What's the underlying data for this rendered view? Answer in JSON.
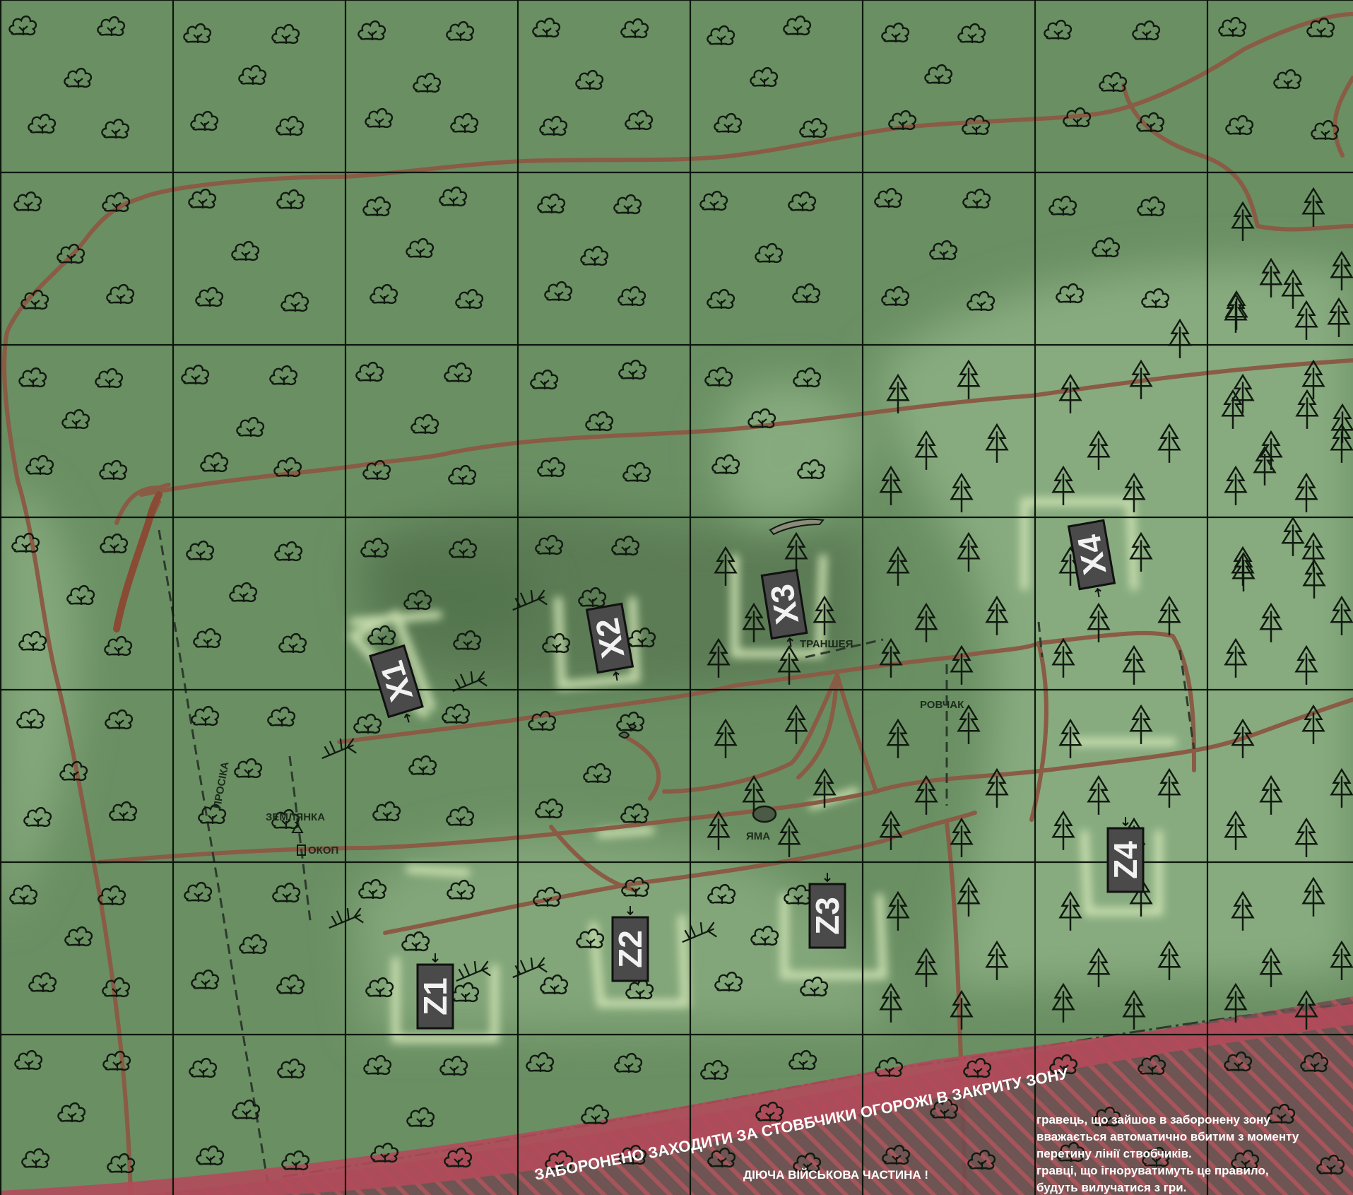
{
  "map": {
    "grid": {
      "columns": 8,
      "rows": 7
    },
    "colors": {
      "forest": "#6a8f63",
      "clearing": "#89ad80",
      "dark_forest": "#5c7f57",
      "road": "#8a5b45",
      "grid_line": "#0d160d",
      "base": "#4a4a4a",
      "base_text": "#f2f2f2",
      "zone_outline": "#cfe3b4",
      "restricted": "#b24a5a",
      "label_text": "#1c2b1b"
    },
    "bases": [
      {
        "id": "X1",
        "label": "X1"
      },
      {
        "id": "X2",
        "label": "X2"
      },
      {
        "id": "X3",
        "label": "X3"
      },
      {
        "id": "X4",
        "label": "X4"
      },
      {
        "id": "Z1",
        "label": "Z1"
      },
      {
        "id": "Z2",
        "label": "Z2"
      },
      {
        "id": "Z3",
        "label": "Z3"
      },
      {
        "id": "Z4",
        "label": "Z4"
      }
    ],
    "labels": {
      "prosika": "ПРОСІКА",
      "zemlyanka": "ЗЕМЛЯНКА",
      "okop": "ОКОП",
      "yama": "ЯМА",
      "transheya": "ТРАНШЕЯ",
      "rovchak": "РОВЧАК"
    },
    "warning_banner": "ЗАБОРОНЕНО ЗАХОДИТИ ЗА СТОВБЧИКИ ОГОРОЖІ В ЗАКРИТУ ЗОНУ",
    "military_unit": "ДІЮЧА ВІЙСЬКОВА ЧАСТИНА !",
    "rules_note": [
      "гравець, що зайшов в заборонену зону",
      "вважається автоматично вбитим з моменту",
      "перетину лінії ствобчиків.",
      "гравці, що ігноруватимуть це правило,",
      "будуть вилучатися з гри."
    ],
    "icons": {
      "deciduous": "bush-tree-icon",
      "conifer": "fir-tree-icon",
      "fallen": "fallen-tree-icon"
    }
  }
}
